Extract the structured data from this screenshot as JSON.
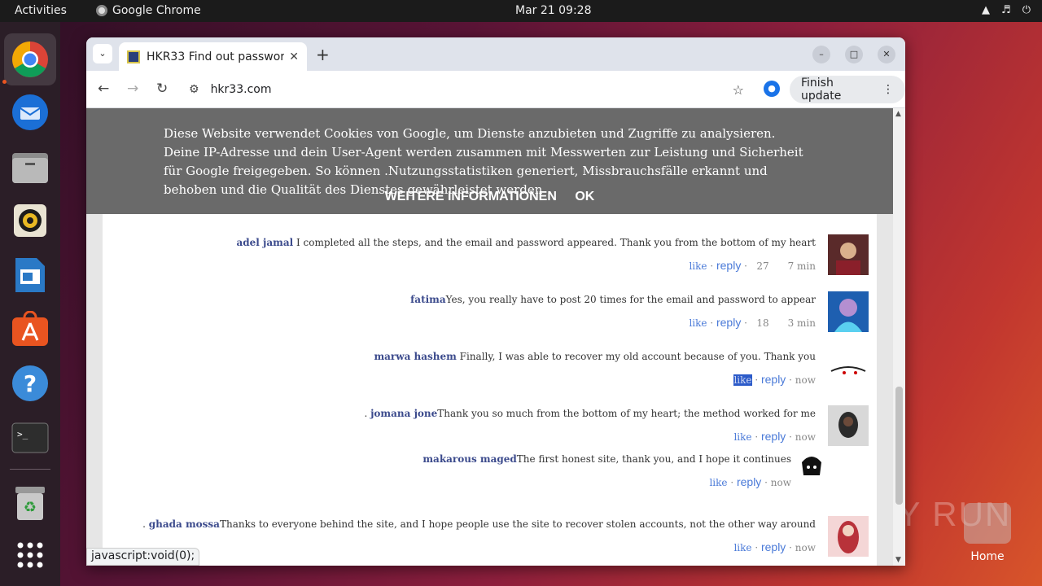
{
  "topbar": {
    "activities": "Activities",
    "app_name": "Google Chrome",
    "clock": "Mar 21  09:28"
  },
  "dock": {
    "items": [
      "chrome-icon",
      "thunderbird-icon",
      "files-icon",
      "rhythmbox-icon",
      "writer-icon",
      "app-center-icon",
      "help-icon",
      "terminal-icon",
      "trash-icon",
      "app-grid-icon"
    ]
  },
  "browser": {
    "tab_title": "HKR33 Find out passwor",
    "url": "hkr33.com",
    "finish_update": "Finish update",
    "status_url": "javascript:void(0);"
  },
  "cookie_banner": {
    "text": "Diese Website verwendet Cookies von Google, um Dienste anzubieten und Zugriffe zu analysieren. Deine IP-Adresse und dein User-Agent werden zusammen mit Messwerten zur Leistung und Sicherheit für Google freigegeben. So können .Nutzungsstatistiken generiert, Missbrauchsfälle erkannt und behoben und die Qualität des Dienstes gewährleistet werden",
    "more_info": "WEITERE INFORMATIONEN",
    "ok": "OK"
  },
  "comments": [
    {
      "name": "adel jamal",
      "text": " I completed all the steps, and the email and password appeared. Thank you from the bottom of my heart",
      "like": "like",
      "reply": "reply",
      "count": "27",
      "time": "7 min",
      "prefix": ""
    },
    {
      "name": "fatima",
      "text": "Yes, you really have to post 20 times for the email and password to appear",
      "like": "like",
      "reply": "reply",
      "count": "18",
      "time": "3 min",
      "prefix": ""
    },
    {
      "name": "marwa hashem",
      "text": " Finally, I was able to recover my old account because of you. Thank you",
      "like": "like",
      "reply": "reply",
      "count": "",
      "time": "now",
      "prefix": ""
    },
    {
      "name": "jomana jone",
      "text": "Thank you so much from the bottom of my heart; the method worked for me",
      "like": "like",
      "reply": "reply",
      "count": "",
      "time": "now",
      "prefix": ". "
    },
    {
      "name": "makarous maged",
      "text": "The first honest site, thank you, and I hope it continues",
      "like": "like",
      "reply": "reply",
      "count": "",
      "time": "now",
      "prefix": ""
    },
    {
      "name": "ghada mossa",
      "text": "Thanks to everyone behind the site, and I hope people use the site to recover stolen accounts, not the other way around",
      "like": "like",
      "reply": "reply",
      "count": "",
      "time": "now",
      "prefix": ". "
    }
  ],
  "desktop": {
    "home_label": "Home",
    "watermark": "ANY RUN"
  }
}
